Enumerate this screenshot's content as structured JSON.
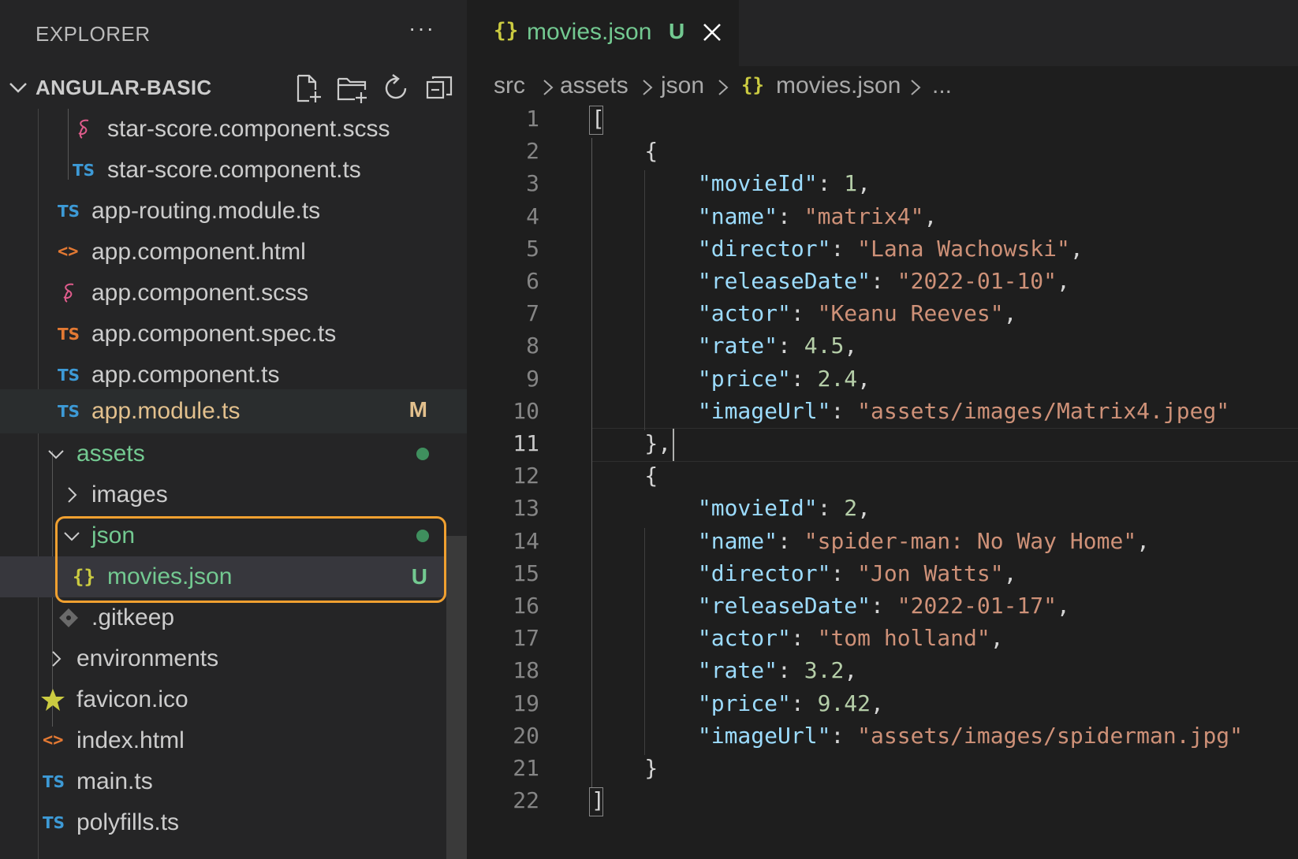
{
  "sidebar": {
    "title": "EXPLORER",
    "more_label": "···",
    "project": "ANGULAR-BASIC",
    "toolbar": [
      "new-file-icon",
      "new-folder-icon",
      "refresh-icon",
      "collapse-all-icon"
    ],
    "tree": [
      {
        "label": "star-score.component.scss",
        "icon": "sass-icon"
      },
      {
        "label": "star-score.component.ts",
        "icon": "ts-icon",
        "icon_text": "TS"
      },
      {
        "label": "app-routing.module.ts",
        "icon": "ts-icon",
        "icon_text": "TS"
      },
      {
        "label": "app.component.html",
        "icon": "html-icon",
        "icon_text": "<>"
      },
      {
        "label": "app.component.scss",
        "icon": "sass-icon"
      },
      {
        "label": "app.component.spec.ts",
        "icon": "ts-icon",
        "icon_text": "TS"
      },
      {
        "label": "app.component.ts",
        "icon": "ts-icon",
        "icon_text": "TS"
      },
      {
        "label": "app.module.ts",
        "icon": "ts-icon",
        "icon_text": "TS",
        "badge": "M"
      },
      {
        "label": "assets",
        "icon": "chevron-down-icon"
      },
      {
        "label": "images",
        "icon": "chevron-right-icon"
      },
      {
        "label": "json",
        "icon": "chevron-down-icon"
      },
      {
        "label": "movies.json",
        "icon": "json-icon",
        "icon_text": "{}",
        "badge": "U"
      },
      {
        "label": ".gitkeep",
        "icon": "git-icon"
      },
      {
        "label": "environments",
        "icon": "chevron-right-icon"
      },
      {
        "label": "favicon.ico",
        "icon": "star-icon"
      },
      {
        "label": "index.html",
        "icon": "html-icon",
        "icon_text": "<>"
      },
      {
        "label": "main.ts",
        "icon": "ts-icon",
        "icon_text": "TS"
      },
      {
        "label": "polyfills.ts",
        "icon": "ts-icon",
        "icon_text": "TS"
      }
    ]
  },
  "editor": {
    "tab": {
      "icon_text": "{}",
      "name": "movies.json",
      "status": "U"
    },
    "breadcrumb": [
      "src",
      "assets",
      "json",
      "movies.json",
      "..."
    ],
    "breadcrumb_icon_text": "{}",
    "line_numbers": [
      "1",
      "2",
      "3",
      "4",
      "5",
      "6",
      "7",
      "8",
      "9",
      "10",
      "11",
      "12",
      "13",
      "14",
      "15",
      "16",
      "17",
      "18",
      "19",
      "20",
      "21",
      "22"
    ],
    "current_line": "11",
    "lines": [
      [
        {
          "t": "p",
          "v": "["
        }
      ],
      [
        {
          "t": "p",
          "v": "    {"
        }
      ],
      [
        {
          "t": "p",
          "v": "        "
        },
        {
          "t": "k",
          "v": "\"movieId\""
        },
        {
          "t": "p",
          "v": ": "
        },
        {
          "t": "n",
          "v": "1"
        },
        {
          "t": "p",
          "v": ","
        }
      ],
      [
        {
          "t": "p",
          "v": "        "
        },
        {
          "t": "k",
          "v": "\"name\""
        },
        {
          "t": "p",
          "v": ": "
        },
        {
          "t": "s",
          "v": "\"matrix4\""
        },
        {
          "t": "p",
          "v": ","
        }
      ],
      [
        {
          "t": "p",
          "v": "        "
        },
        {
          "t": "k",
          "v": "\"director\""
        },
        {
          "t": "p",
          "v": ": "
        },
        {
          "t": "s",
          "v": "\"Lana Wachowski\""
        },
        {
          "t": "p",
          "v": ","
        }
      ],
      [
        {
          "t": "p",
          "v": "        "
        },
        {
          "t": "k",
          "v": "\"releaseDate\""
        },
        {
          "t": "p",
          "v": ": "
        },
        {
          "t": "s",
          "v": "\"2022-01-10\""
        },
        {
          "t": "p",
          "v": ","
        }
      ],
      [
        {
          "t": "p",
          "v": "        "
        },
        {
          "t": "k",
          "v": "\"actor\""
        },
        {
          "t": "p",
          "v": ": "
        },
        {
          "t": "s",
          "v": "\"Keanu Reeves\""
        },
        {
          "t": "p",
          "v": ","
        }
      ],
      [
        {
          "t": "p",
          "v": "        "
        },
        {
          "t": "k",
          "v": "\"rate\""
        },
        {
          "t": "p",
          "v": ": "
        },
        {
          "t": "n",
          "v": "4.5"
        },
        {
          "t": "p",
          "v": ","
        }
      ],
      [
        {
          "t": "p",
          "v": "        "
        },
        {
          "t": "k",
          "v": "\"price\""
        },
        {
          "t": "p",
          "v": ": "
        },
        {
          "t": "n",
          "v": "2.4"
        },
        {
          "t": "p",
          "v": ","
        }
      ],
      [
        {
          "t": "p",
          "v": "        "
        },
        {
          "t": "k",
          "v": "\"imageUrl\""
        },
        {
          "t": "p",
          "v": ": "
        },
        {
          "t": "s",
          "v": "\"assets/images/Matrix4.jpeg\""
        }
      ],
      [
        {
          "t": "p",
          "v": "    },"
        }
      ],
      [
        {
          "t": "p",
          "v": "    {"
        }
      ],
      [
        {
          "t": "p",
          "v": "        "
        },
        {
          "t": "k",
          "v": "\"movieId\""
        },
        {
          "t": "p",
          "v": ": "
        },
        {
          "t": "n",
          "v": "2"
        },
        {
          "t": "p",
          "v": ","
        }
      ],
      [
        {
          "t": "p",
          "v": "        "
        },
        {
          "t": "k",
          "v": "\"name\""
        },
        {
          "t": "p",
          "v": ": "
        },
        {
          "t": "s",
          "v": "\"spider-man: No Way Home\""
        },
        {
          "t": "p",
          "v": ","
        }
      ],
      [
        {
          "t": "p",
          "v": "        "
        },
        {
          "t": "k",
          "v": "\"director\""
        },
        {
          "t": "p",
          "v": ": "
        },
        {
          "t": "s",
          "v": "\"Jon Watts\""
        },
        {
          "t": "p",
          "v": ","
        }
      ],
      [
        {
          "t": "p",
          "v": "        "
        },
        {
          "t": "k",
          "v": "\"releaseDate\""
        },
        {
          "t": "p",
          "v": ": "
        },
        {
          "t": "s",
          "v": "\"2022-01-17\""
        },
        {
          "t": "p",
          "v": ","
        }
      ],
      [
        {
          "t": "p",
          "v": "        "
        },
        {
          "t": "k",
          "v": "\"actor\""
        },
        {
          "t": "p",
          "v": ": "
        },
        {
          "t": "s",
          "v": "\"tom holland\""
        },
        {
          "t": "p",
          "v": ","
        }
      ],
      [
        {
          "t": "p",
          "v": "        "
        },
        {
          "t": "k",
          "v": "\"rate\""
        },
        {
          "t": "p",
          "v": ": "
        },
        {
          "t": "n",
          "v": "3.2"
        },
        {
          "t": "p",
          "v": ","
        }
      ],
      [
        {
          "t": "p",
          "v": "        "
        },
        {
          "t": "k",
          "v": "\"price\""
        },
        {
          "t": "p",
          "v": ": "
        },
        {
          "t": "n",
          "v": "9.42"
        },
        {
          "t": "p",
          "v": ","
        }
      ],
      [
        {
          "t": "p",
          "v": "        "
        },
        {
          "t": "k",
          "v": "\"imageUrl\""
        },
        {
          "t": "p",
          "v": ": "
        },
        {
          "t": "s",
          "v": "\"assets/images/spiderman.jpg\""
        }
      ],
      [
        {
          "t": "p",
          "v": "    }"
        }
      ],
      [
        {
          "t": "p",
          "v": "]"
        }
      ]
    ]
  },
  "colors": {
    "git_untracked": "#73c991",
    "git_modified": "#e2c08d",
    "highlight_box": "#f0a030",
    "json_key": "#9cdcfe",
    "json_string": "#ce9178",
    "json_number": "#b5cea8"
  }
}
